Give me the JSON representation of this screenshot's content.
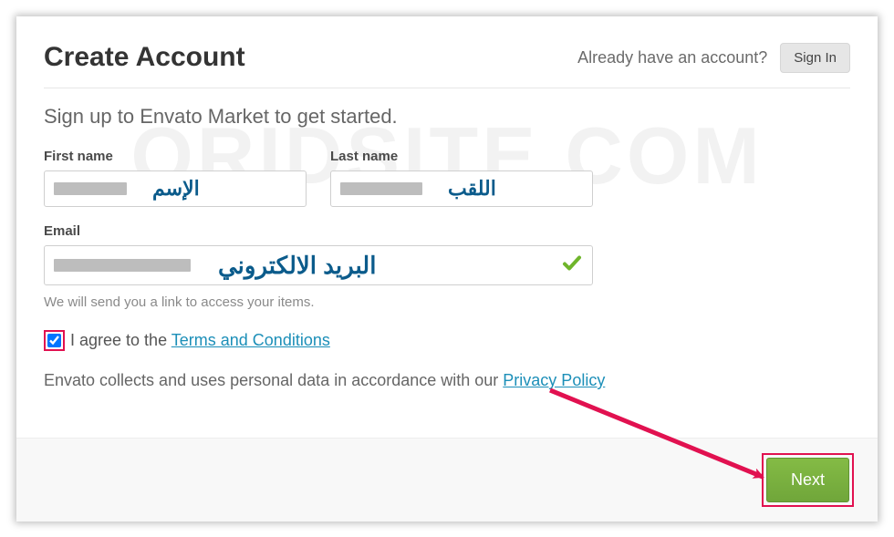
{
  "watermark": "ORIDSITE.COM",
  "header": {
    "title": "Create Account",
    "already_text": "Already have an account?",
    "signin_label": "Sign In"
  },
  "subtitle": "Sign up to Envato Market to get started.",
  "fields": {
    "first_name": {
      "label": "First name",
      "annotation": "الإسم"
    },
    "last_name": {
      "label": "Last name",
      "annotation": "اللقب"
    },
    "email": {
      "label": "Email",
      "annotation": "البريد الالكتروني",
      "helper": "We will send you a link to access your items."
    }
  },
  "agree": {
    "prefix": "I agree to the ",
    "link_text": "Terms and Conditions",
    "checked": true
  },
  "privacy": {
    "prefix": "Envato collects and uses personal data in accordance with our ",
    "link_text": "Privacy Policy"
  },
  "footer": {
    "next_label": "Next"
  }
}
